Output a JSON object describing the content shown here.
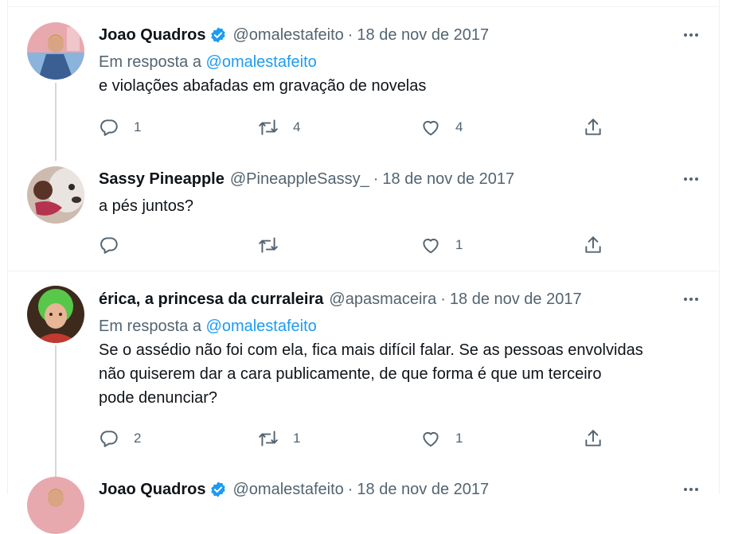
{
  "tweets": [
    {
      "name": "Joao Quadros",
      "verified": true,
      "handle": "@omalestafeito",
      "separator": "·",
      "date": "18 de nov de 2017",
      "reply_to_prefix": "Em resposta a",
      "reply_to_handle": "@omalestafeito",
      "text": "e violações abafadas em gravação de novelas",
      "replies": "1",
      "retweets": "4",
      "likes": "4"
    },
    {
      "name": "Sassy Pineapple",
      "verified": false,
      "handle": "@PineappleSassy_",
      "separator": "·",
      "date": "18 de nov de 2017",
      "text": "a pés juntos?",
      "replies": "",
      "retweets": "",
      "likes": "1"
    },
    {
      "name": "érica, a princesa da curraleira",
      "verified": false,
      "handle": "@apasmaceira",
      "separator": "·",
      "date": "18 de nov de 2017",
      "reply_to_prefix": "Em resposta a",
      "reply_to_handle": "@omalestafeito",
      "text_lines": [
        "Se o assédio não foi com ela, fica mais difícil falar. Se as pessoas envolvidas",
        "não quiserem dar a cara publicamente, de que forma é que um terceiro",
        "pode denunciar?"
      ],
      "replies": "2",
      "retweets": "1",
      "likes": "1"
    },
    {
      "name": "Joao Quadros",
      "verified": true,
      "handle": "@omalestafeito",
      "separator": "·",
      "date": "18 de nov de 2017"
    }
  ],
  "icons": {
    "reply": "reply-icon",
    "retweet": "retweet-icon",
    "like": "like-icon",
    "share": "share-icon",
    "more": "more-icon",
    "verified": "verified-badge-icon"
  },
  "colors": {
    "text": "#0f1419",
    "secondary": "#536471",
    "link": "#1d9bf0",
    "divider": "#eff3f4",
    "thread_line": "#cfd9de"
  }
}
